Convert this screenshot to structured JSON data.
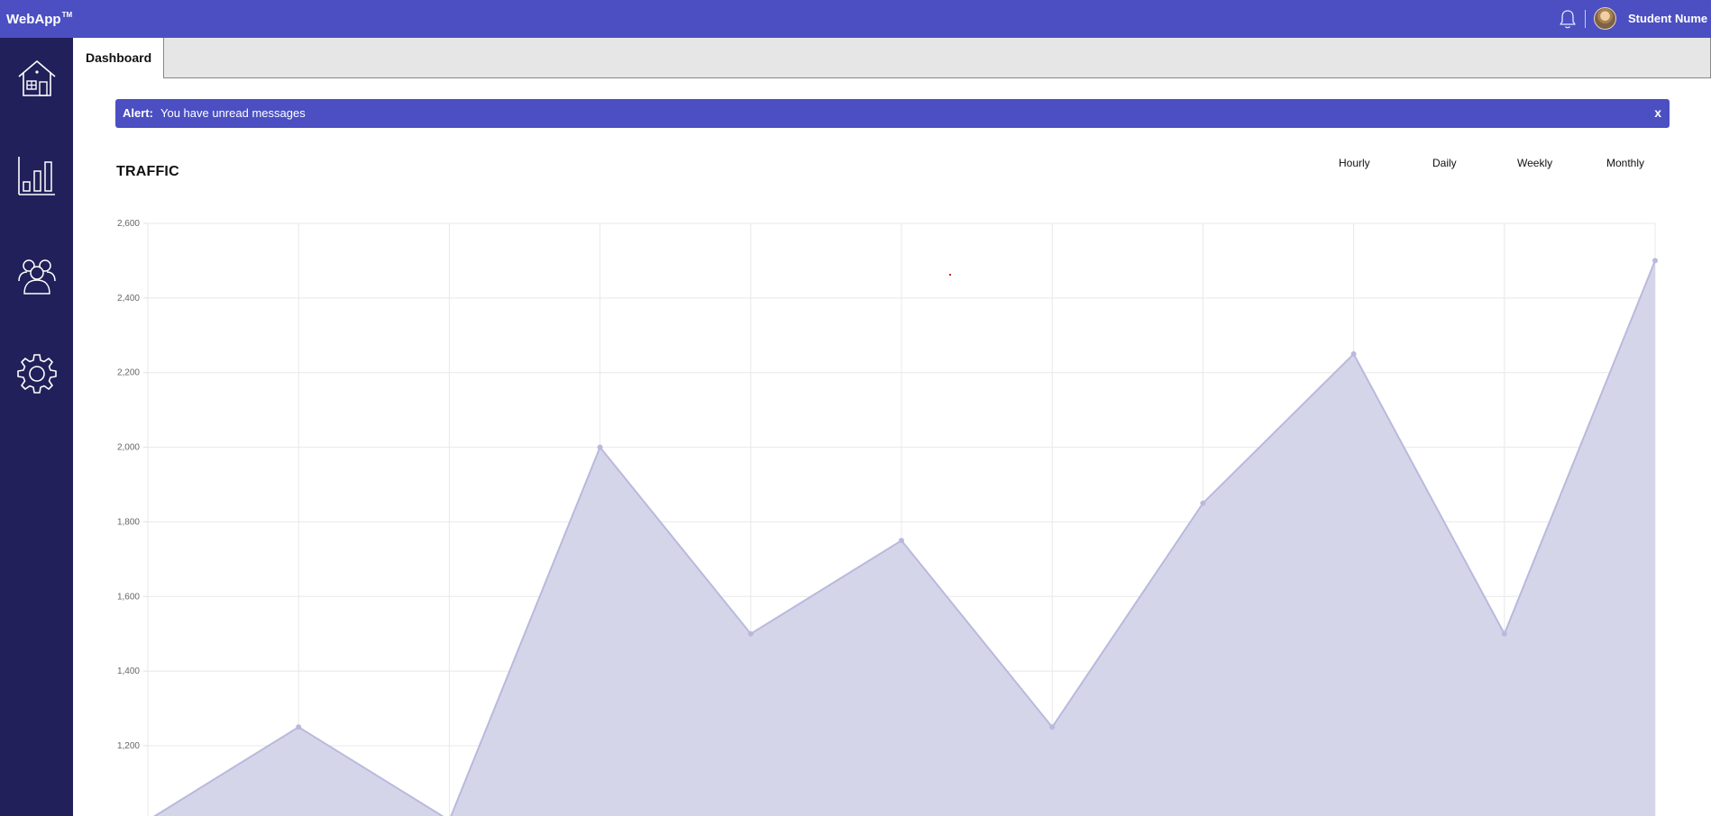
{
  "topbar": {
    "brand": "WebApp",
    "brand_mark": "TM",
    "user_name": "Student Nume",
    "icons": {
      "notifications": "bell-icon",
      "avatar": "user-avatar"
    },
    "color": "#4b4fc2"
  },
  "sidebar": {
    "color": "#21205a",
    "items": [
      {
        "name": "home",
        "icon": "house-icon"
      },
      {
        "name": "analytics",
        "icon": "bar-chart-icon"
      },
      {
        "name": "members",
        "icon": "users-icon"
      },
      {
        "name": "settings",
        "icon": "gear-icon"
      }
    ]
  },
  "tabs": [
    {
      "label": "Dashboard",
      "active": true
    }
  ],
  "alert": {
    "label": "Alert:",
    "message": "You have unread messages",
    "close": "x"
  },
  "traffic": {
    "title": "TRAFFIC",
    "periods": [
      "Hourly",
      "Daily",
      "Weekly",
      "Monthly"
    ]
  },
  "chart_data": {
    "type": "area",
    "x": [
      0,
      1,
      2,
      3,
      4,
      5,
      6,
      7,
      8,
      9,
      10
    ],
    "values": [
      1000,
      1250,
      1000,
      2000,
      1500,
      1750,
      1250,
      1850,
      2250,
      1500,
      2500
    ],
    "y_ticks": [
      "1,200",
      "1,400",
      "1,600",
      "1,800",
      "2,000",
      "2,200",
      "2,400",
      "2,600"
    ],
    "ylim": [
      1100,
      2600
    ],
    "grid": true,
    "fill_color": "#d5d5ea",
    "line_color": "#b9b9dd"
  }
}
